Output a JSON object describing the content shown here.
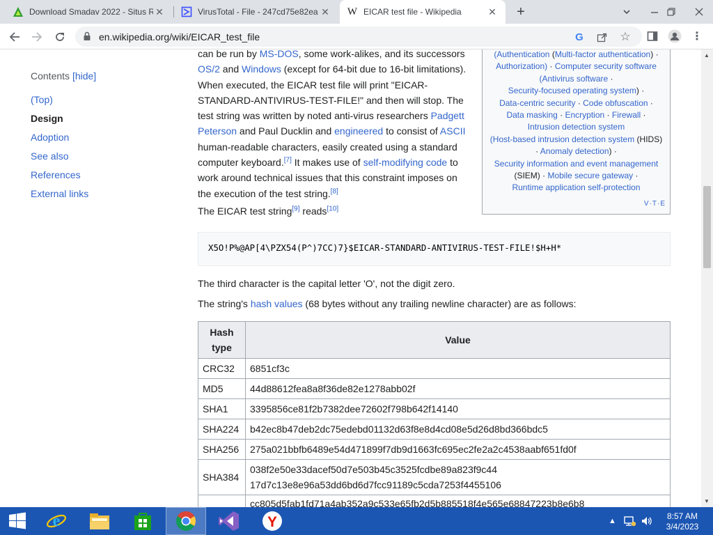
{
  "browser": {
    "tabs": [
      {
        "title": "Download Smadav 2022 - Situs R",
        "icon": "smadav-icon"
      },
      {
        "title": "VirusTotal - File - 247cd75e82ea",
        "icon": "virustotal-icon"
      },
      {
        "title": "EICAR test file - Wikipedia",
        "icon": "wikipedia-icon",
        "active": true
      }
    ],
    "url": "en.wikipedia.org/wiki/EICAR_test_file"
  },
  "toc": {
    "title": "Contents",
    "hide_label": "[hide]",
    "items": [
      "(Top)",
      "Design",
      "Adoption",
      "See also",
      "References",
      "External links"
    ],
    "current": "Design"
  },
  "article": {
    "p1": {
      "t1": "can be run by ",
      "l1": "MS-DOS",
      "t2": ", some work-alikes, and its successors ",
      "l2": "OS/2",
      "t3": " and ",
      "l3": "Windows",
      "t4": " (except for 64-bit due to 16-bit limitations). When executed, the EICAR test file will print \"EICAR-STANDARD-ANTIVIRUS-TEST-FILE!\" and then will stop. The test string was written by noted anti-virus researchers ",
      "l4": "Padgett Peterson",
      "t5": " and Paul Ducklin and ",
      "l5": "engineered",
      "t6": " to consist of ",
      "l6": "ASCII",
      "t7": " human-readable characters, easily created using a standard computer keyboard.",
      "ref1": "[7]",
      "t8": " It makes use of ",
      "l7": "self-modifying code",
      "t9": " to work around technical issues that this constraint imposes on the execution of the test string.",
      "ref2": "[8]"
    },
    "reads": {
      "t1": "The EICAR test string",
      "ref1": "[9]",
      "t2": " reads",
      "ref2": "[10]"
    },
    "test_string": "X5O!P%@AP[4\\PZX54(P^)7CC)7}$EICAR-STANDARD-ANTIVIRUS-TEST-FILE!$H+H*",
    "third_char": "The third character is the capital letter 'O', not the digit zero.",
    "hash_intro": {
      "t1": "The string's ",
      "l1": "hash values",
      "t2": " (68 bytes without any trailing newline character) are as follows:"
    }
  },
  "infobox": {
    "lines": [
      {
        "parts": [
          [
            "link",
            "(Authentication"
          ],
          [
            "text",
            " ("
          ],
          [
            "link",
            "Multi-factor authentication"
          ],
          [
            "text",
            ") ·"
          ]
        ]
      },
      {
        "parts": [
          [
            "link",
            "Authorization)"
          ],
          [
            "text",
            " · "
          ],
          [
            "link",
            "Computer security software"
          ]
        ]
      },
      {
        "parts": [
          [
            "link",
            "(Antivirus software"
          ],
          [
            "text",
            " ·"
          ]
        ]
      },
      {
        "parts": [
          [
            "link",
            "Security-focused operating system"
          ],
          [
            "text",
            ") ·"
          ]
        ]
      },
      {
        "parts": [
          [
            "link",
            "Data-centric security"
          ],
          [
            "text",
            " · "
          ],
          [
            "link",
            "Code obfuscation"
          ],
          [
            "text",
            " ·"
          ]
        ]
      },
      {
        "parts": [
          [
            "link",
            "Data masking"
          ],
          [
            "text",
            " · "
          ],
          [
            "link",
            "Encryption"
          ],
          [
            "text",
            " · "
          ],
          [
            "link",
            "Firewall"
          ],
          [
            "text",
            " ·"
          ]
        ]
      },
      {
        "parts": [
          [
            "link",
            "Intrusion detection system"
          ]
        ]
      },
      {
        "parts": [
          [
            "link",
            "(Host-based intrusion detection system"
          ],
          [
            "text",
            " (HIDS)"
          ]
        ]
      },
      {
        "parts": [
          [
            "text",
            "· "
          ],
          [
            "link",
            "Anomaly detection"
          ],
          [
            "text",
            ") ·"
          ]
        ]
      },
      {
        "parts": [
          [
            "link",
            "Security information and event management"
          ]
        ]
      },
      {
        "parts": [
          [
            "text",
            "(SIEM) · "
          ],
          [
            "link",
            "Mobile secure gateway"
          ],
          [
            "text",
            " ·"
          ]
        ]
      },
      {
        "parts": [
          [
            "link",
            "Runtime application self-protection"
          ]
        ]
      }
    ],
    "vte": "V·T·E"
  },
  "hash_table": {
    "headers": [
      "Hash type",
      "Value"
    ],
    "rows": [
      {
        "type": "CRC32",
        "value": "6851cf3c"
      },
      {
        "type": "MD5",
        "value": "44d88612fea8a8f36de82e1278abb02f"
      },
      {
        "type": "SHA1",
        "value": "3395856ce81f2b7382dee72602f798b642f14140"
      },
      {
        "type": "SHA224",
        "value": "b42ec8b47deb2dc75edebd01132d63f8e8d4cd08e5d26d8bd366bdc5"
      },
      {
        "type": "SHA256",
        "value": "275a021bbfb6489e54d471899f7db9d1663fc695ec2fe2a2c4538aabf651fd0f"
      },
      {
        "type": "SHA384",
        "value": "038f2e50e33dacef50d7e503b45c3525fcdbe89a823f9c44",
        "value2": "17d7c13e8e96a53dd6bd6d7fcc91189c5cda7253f4455106"
      },
      {
        "type": "",
        "value": "cc805d5fab1fd71a4ab352a9c533e65fb2d5b885518f4e565e68847223b8e6b8"
      }
    ]
  },
  "taskbar": {
    "apps": [
      "start-icon",
      "internet-explorer-icon",
      "file-explorer-icon",
      "store-icon",
      "chrome-icon",
      "visual-studio-icon",
      "yandex-icon"
    ],
    "clock_time": "8:57 AM",
    "clock_date": "3/4/2023"
  }
}
